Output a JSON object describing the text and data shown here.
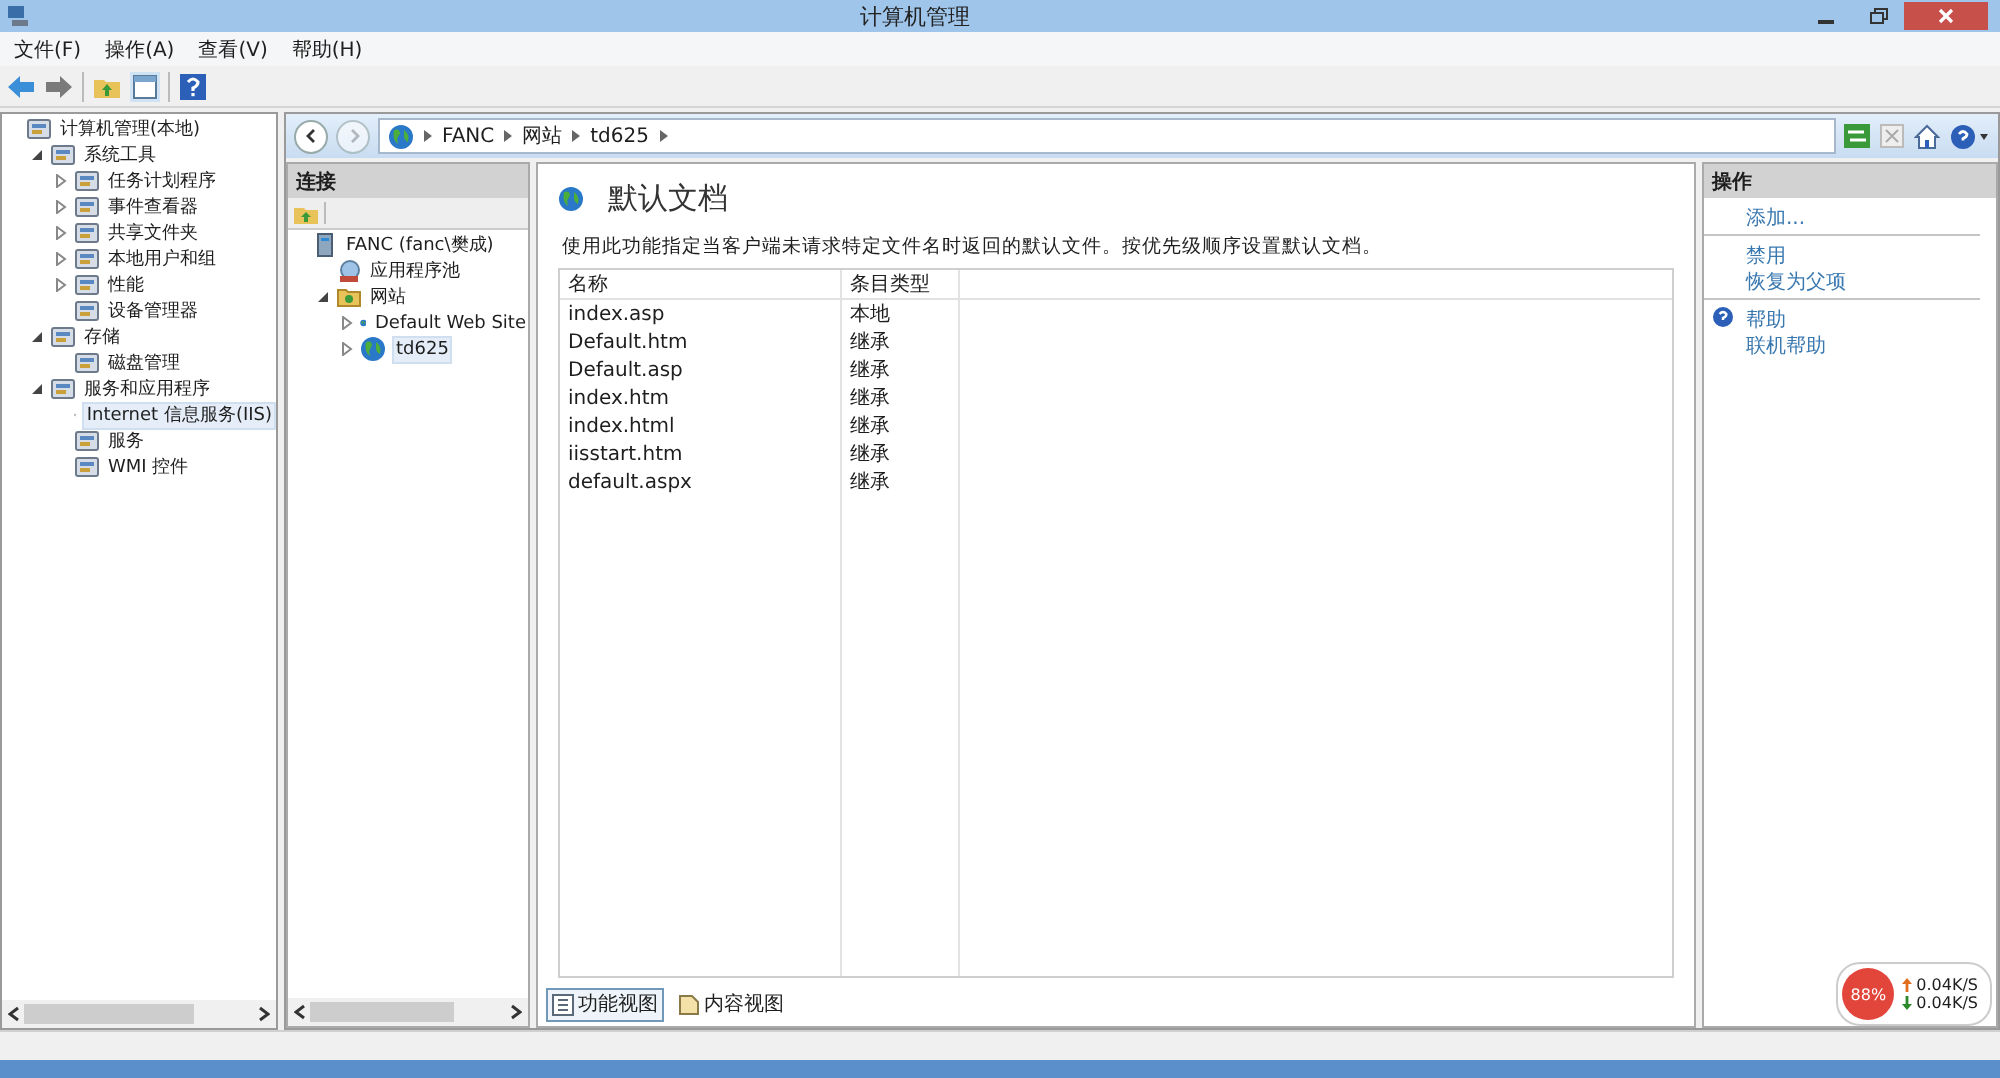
{
  "window": {
    "title": "计算机管理"
  },
  "menu": [
    "文件(F)",
    "操作(A)",
    "查看(V)",
    "帮助(H)"
  ],
  "tree": [
    {
      "label": "计算机管理(本地)",
      "selected": false,
      "children": [
        {
          "label": "系统工具",
          "expanded": true,
          "selected": false,
          "children": [
            {
              "label": "任务计划程序",
              "expanded": false,
              "selected": false
            },
            {
              "label": "事件查看器",
              "expanded": false,
              "selected": false
            },
            {
              "label": "共享文件夹",
              "expanded": false,
              "selected": false
            },
            {
              "label": "本地用户和组",
              "expanded": false,
              "selected": false
            },
            {
              "label": "性能",
              "expanded": false,
              "selected": false
            },
            {
              "label": "设备管理器",
              "selected": false
            }
          ]
        },
        {
          "label": "存储",
          "expanded": true,
          "selected": false,
          "children": [
            {
              "label": "磁盘管理",
              "selected": false
            }
          ]
        },
        {
          "label": "服务和应用程序",
          "expanded": true,
          "selected": false,
          "children": [
            {
              "label": "Internet 信息服务(IIS)",
              "selected": true
            },
            {
              "label": "服务",
              "selected": false
            },
            {
              "label": "WMI 控件",
              "selected": false
            }
          ]
        }
      ]
    }
  ],
  "breadcrumb": [
    "FANC",
    "网站",
    "td625"
  ],
  "connections": {
    "title": "连接",
    "tree": [
      {
        "label": "FANC (fanc\\樊成)",
        "kind": "server",
        "selected": false,
        "children": [
          {
            "label": "应用程序池",
            "kind": "pool",
            "selected": false
          },
          {
            "label": "网站",
            "kind": "folder",
            "expanded": true,
            "selected": false,
            "children": [
              {
                "label": "Default Web Site",
                "kind": "site",
                "expanded": false,
                "selected": false
              },
              {
                "label": "td625",
                "kind": "site",
                "expanded": false,
                "selected": true
              }
            ]
          }
        ]
      }
    ]
  },
  "feature": {
    "title": "默认文档",
    "description": "使用此功能指定当客户端未请求特定文件名时返回的默认文件。按优先级顺序设置默认文档。",
    "columns": [
      "名称",
      "条目类型"
    ],
    "rows": [
      [
        "index.asp",
        "本地"
      ],
      [
        "Default.htm",
        "继承"
      ],
      [
        "Default.asp",
        "继承"
      ],
      [
        "index.htm",
        "继承"
      ],
      [
        "index.html",
        "继承"
      ],
      [
        "iisstart.htm",
        "继承"
      ],
      [
        "default.aspx",
        "继承"
      ]
    ]
  },
  "view_tabs": [
    {
      "label": "功能视图",
      "selected": true
    },
    {
      "label": "内容视图",
      "selected": false
    }
  ],
  "actions": {
    "title": "操作",
    "groups": [
      [
        {
          "label": "添加...",
          "kind": "plain"
        }
      ],
      [
        {
          "label": "禁用",
          "kind": "plain"
        },
        {
          "label": "恢复为父项",
          "kind": "plain"
        }
      ],
      [
        {
          "label": "帮助",
          "kind": "help"
        },
        {
          "label": "联机帮助",
          "kind": "plain"
        }
      ]
    ]
  },
  "net_widget": {
    "percent": "88%",
    "up": "0.04K/S",
    "down": "0.04K/S"
  }
}
